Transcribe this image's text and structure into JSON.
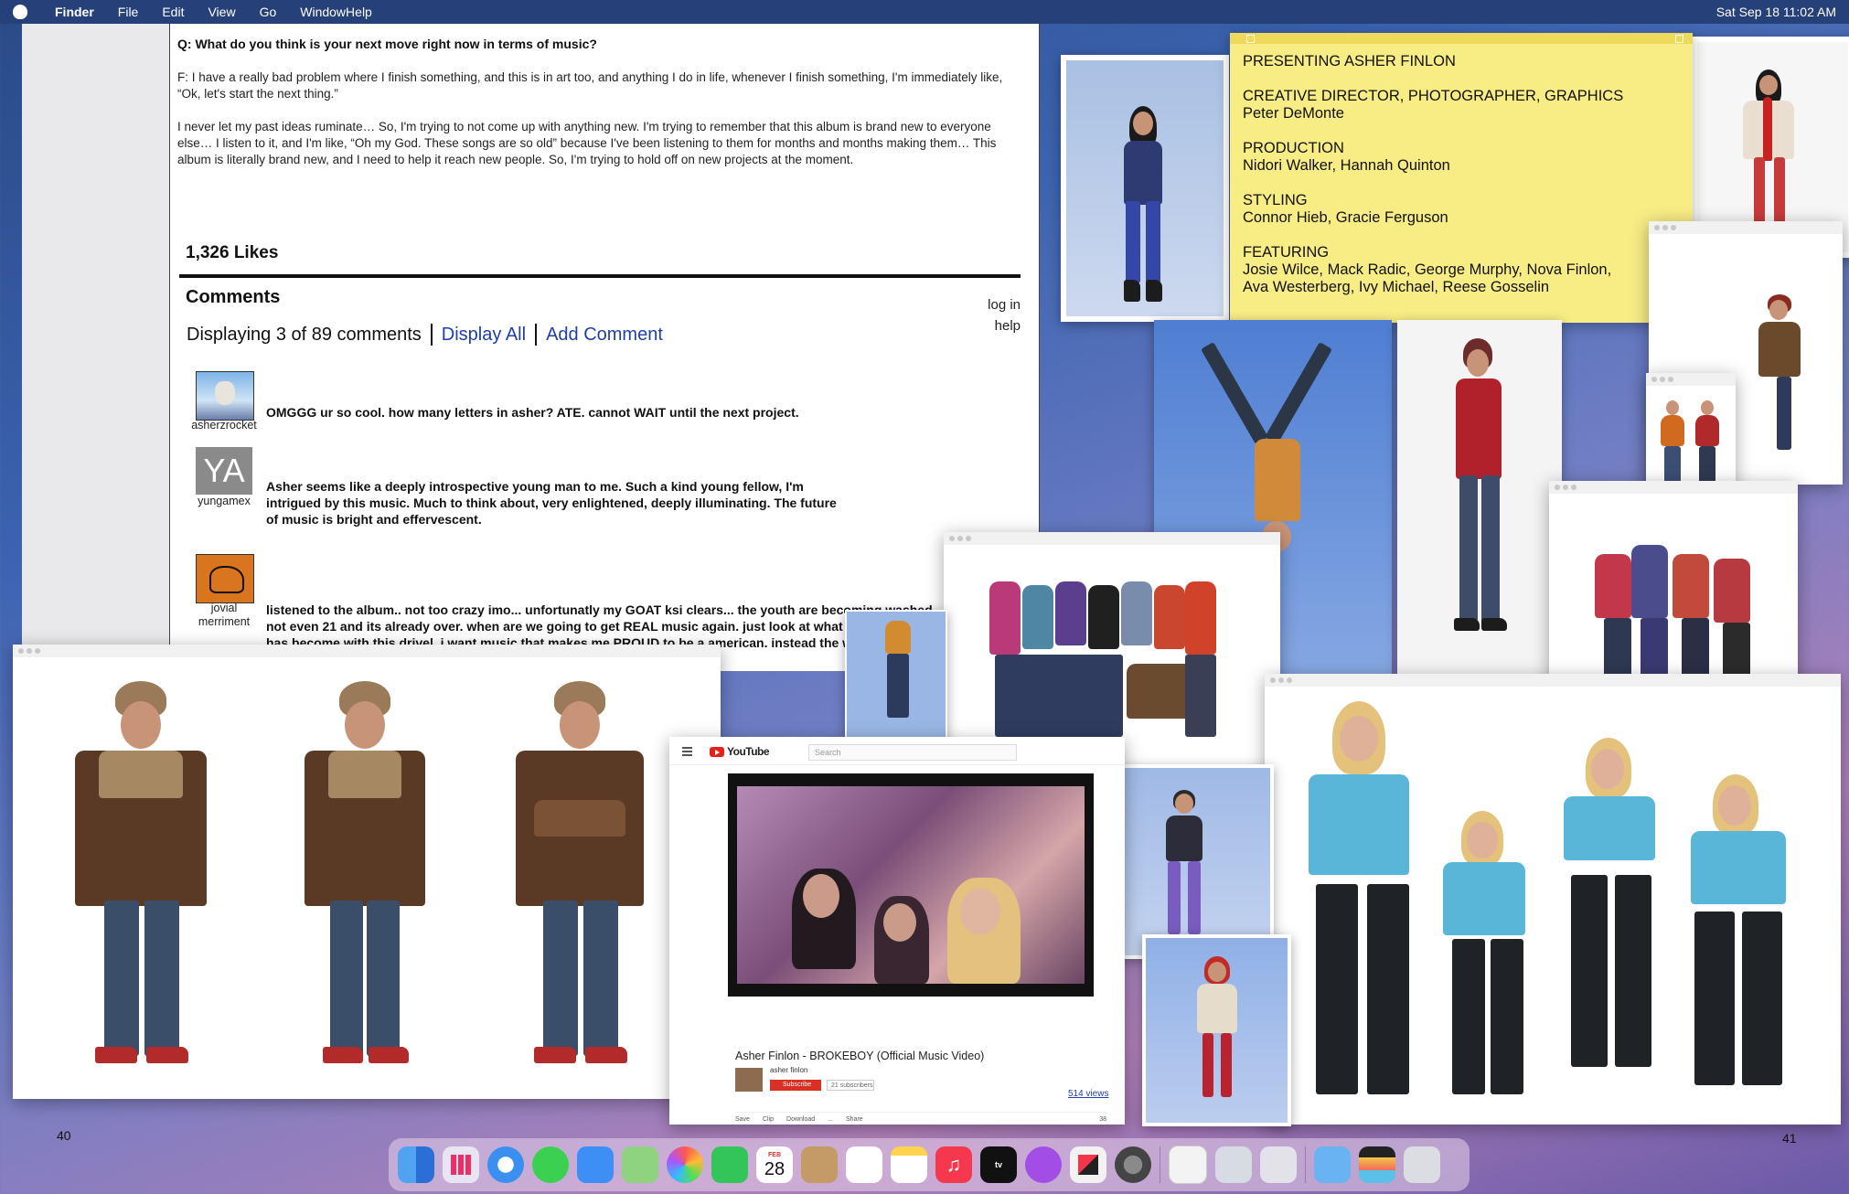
{
  "menubar": {
    "app": "Finder",
    "items": [
      "File",
      "Edit",
      "View",
      "Go",
      "WindowHelp"
    ],
    "clock": "Sat Sep 18  11:02 AM"
  },
  "article": {
    "question": "Q: What do you think is your next move right now in terms of music?",
    "answer1": "F: I have a really bad problem where I finish something, and this is in art too, and anything I do in life, whenever I finish something, I'm immediately like, “Ok, let's start the next thing.”",
    "answer2": "I never let my past ideas ruminate… So, I'm trying to not come up with anything new. I'm trying to remember that this album is brand new to everyone else… I listen to it, and I'm like, “Oh my God. These songs are so old” because I've been listening to them for months and months making them… This album is literally brand new, and I need to help it reach new people. So, I'm trying to hold off on new projects at the moment.",
    "likes": "1,326 Likes",
    "comments_title": "Comments",
    "displaying": "Displaying 3 of 89 comments",
    "display_all": "Display All",
    "add_comment": "Add Comment",
    "log_in": "log in",
    "help": "help",
    "comments": [
      {
        "user": "asherzrocket",
        "text": "OMGGG ur so cool. how many letters in asher? ATE. cannot WAIT until the next project."
      },
      {
        "user": "yungamex",
        "avatar_text": "YA",
        "text": "Asher seems like a deeply introspective young man to me. Such a kind young fellow, I'm intrigued by this music. Much to think about, very enlightened, deeply illuminating. The future of music is bright and effervescent."
      },
      {
        "user": "jovial merriment",
        "text": "listened to the album.. not too crazy imo... unfortunatly my GOAT ksi clears... the youth are becoming washed not even 21 and its already over. when are we going to get REAL music again. just look at what our country has become with this drivel. i want music that makes me PROUD to be a american. instead the woke is infecting us at every turn... what a disappointment..."
      }
    ]
  },
  "credits": {
    "presenting": "PRESENTING ASHER FINLON",
    "cd_label": "CREATIVE DIRECTOR, PHOTOGRAPHER, GRAPHICS",
    "cd_names": "Peter DeMonte",
    "prod_label": "PRODUCTION",
    "prod_names": "Nidori Walker, Hannah Quinton",
    "styling_label": "STYLING",
    "styling_names": "Connor Hieb, Gracie Ferguson",
    "featuring_label": "FEATURING",
    "featuring_names1": "Josie Wilce, Mack Radic, George Murphy, Nova Finlon,",
    "featuring_names2": "Ava Westerberg, Ivy Michael, Reese Gosselin"
  },
  "youtube": {
    "logo": "YouTube",
    "search_placeholder": "Search",
    "video_title": "Asher Finlon - BROKEBOY (Official Music Video)",
    "channel": "asher finlon",
    "subscribe": "Subscribe",
    "subscribers": "21 subscribers",
    "views": "514 views",
    "actions": [
      "Save",
      "Clip",
      "Download",
      "...",
      "Share",
      "38"
    ]
  },
  "pages": {
    "left": "40",
    "right": "41"
  },
  "dock": {
    "calendar_month": "FEB",
    "calendar_day": "28",
    "tv": "tv"
  },
  "colors": {
    "link": "#1f3fa8",
    "note": "#f8ec85",
    "youtube_red": "#e62117",
    "backdrop": "#3c63b0"
  }
}
